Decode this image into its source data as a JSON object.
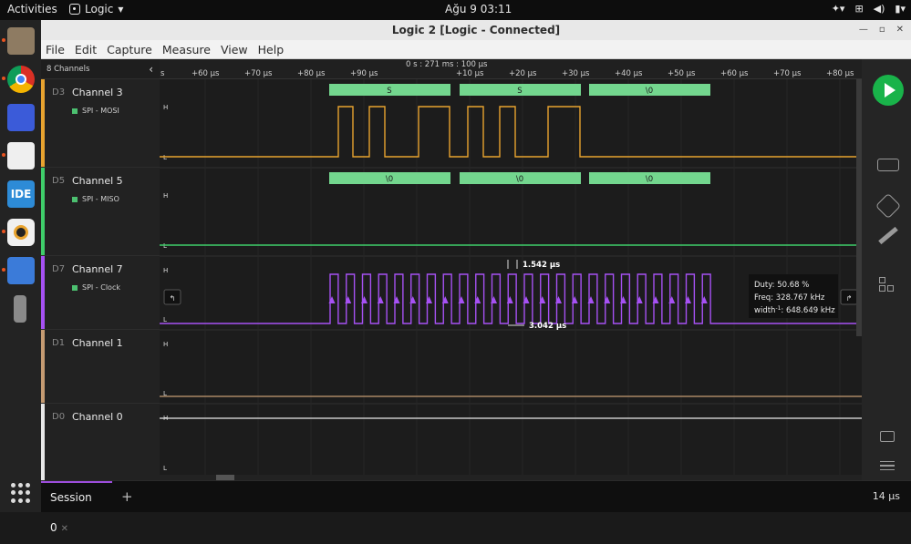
{
  "topbar": {
    "activities": "Activities",
    "app_name": "Logic",
    "clock": "Ağu 9  03:11"
  },
  "window": {
    "title": "Logic 2 [Logic - Connected]"
  },
  "menu": [
    "File",
    "Edit",
    "Capture",
    "Measure",
    "View",
    "Help"
  ],
  "sidebar": {
    "header": "8 Channels",
    "channels": [
      {
        "id": "D3",
        "name": "Channel 3",
        "protocol": "SPI - MOSI",
        "color": "#e8a32f"
      },
      {
        "id": "D5",
        "name": "Channel 5",
        "protocol": "SPI - MISO",
        "color": "#3fce6a"
      },
      {
        "id": "D7",
        "name": "Channel 7",
        "protocol": "SPI - Clock",
        "color": "#a651f3"
      },
      {
        "id": "D1",
        "name": "Channel 1",
        "protocol": "",
        "color": "#c59b72"
      },
      {
        "id": "D0",
        "name": "Channel 0",
        "protocol": "",
        "color": "#e8e8e8"
      }
    ]
  },
  "axis": {
    "reference": "0 s : 271 ms : 100 µs",
    "ticks": [
      "s",
      "+60 µs",
      "+70 µs",
      "+80 µs",
      "+90 µs",
      "+10 µs",
      "+20 µs",
      "+30 µs",
      "+40 µs",
      "+50 µs",
      "+60 µs",
      "+70 µs",
      "+80 µs"
    ]
  },
  "decoded": {
    "mosi": [
      "S",
      "S",
      "\\0"
    ],
    "miso": [
      "\\0",
      "\\0",
      "\\0"
    ]
  },
  "levels": {
    "high": "H",
    "low": "L"
  },
  "clock_pulses": 24,
  "measure": {
    "pulse_width": "1.542 µs",
    "period": "3.042 µs",
    "duty": "Duty: 50.68 %",
    "freq": "Freq: 328.767 kHz",
    "width_prefix": "width",
    "width_sup": "-1",
    "width_value": ": 648.649 kHz"
  },
  "session": {
    "tab": "Session 0",
    "zoom": "14 µs"
  },
  "colors": {
    "mosi": "#e8a32f",
    "miso": "#3fce6a",
    "clock": "#a651f3",
    "decode": "#73d68e",
    "accent": "#9d4edd",
    "run": "#19b34a"
  }
}
